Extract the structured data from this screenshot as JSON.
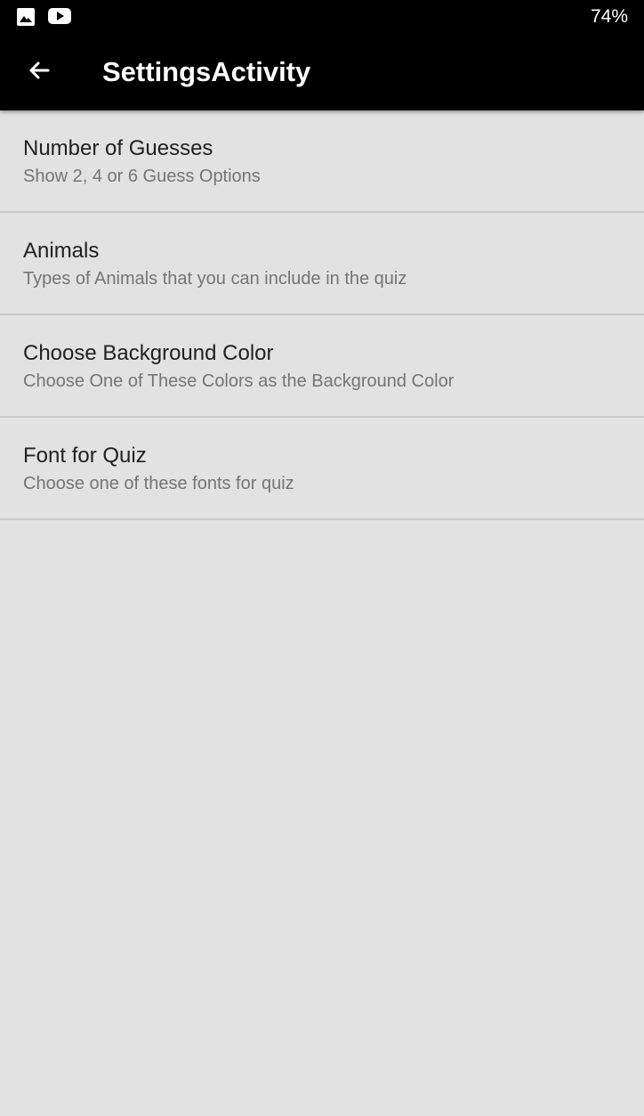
{
  "status_bar": {
    "battery": "74%",
    "icons": [
      "image-icon",
      "youtube-icon"
    ]
  },
  "app_bar": {
    "title": "SettingsActivity",
    "back_icon": "arrow-back-icon"
  },
  "preferences": [
    {
      "title": "Number of Guesses",
      "summary": "Show 2, 4 or 6 Guess Options"
    },
    {
      "title": "Animals",
      "summary": "Types of Animals that you can include in the quiz"
    },
    {
      "title": "Choose Background Color",
      "summary": "Choose One of These Colors as the Background Color"
    },
    {
      "title": "Font for Quiz",
      "summary": "Choose one of these fonts for quiz"
    }
  ],
  "colors": {
    "status_bar": "#000000",
    "app_bar": "#000000",
    "background": "#e2e2e2",
    "title_text": "#212121",
    "summary_text": "#757575",
    "divider": "#c9c9c9"
  }
}
